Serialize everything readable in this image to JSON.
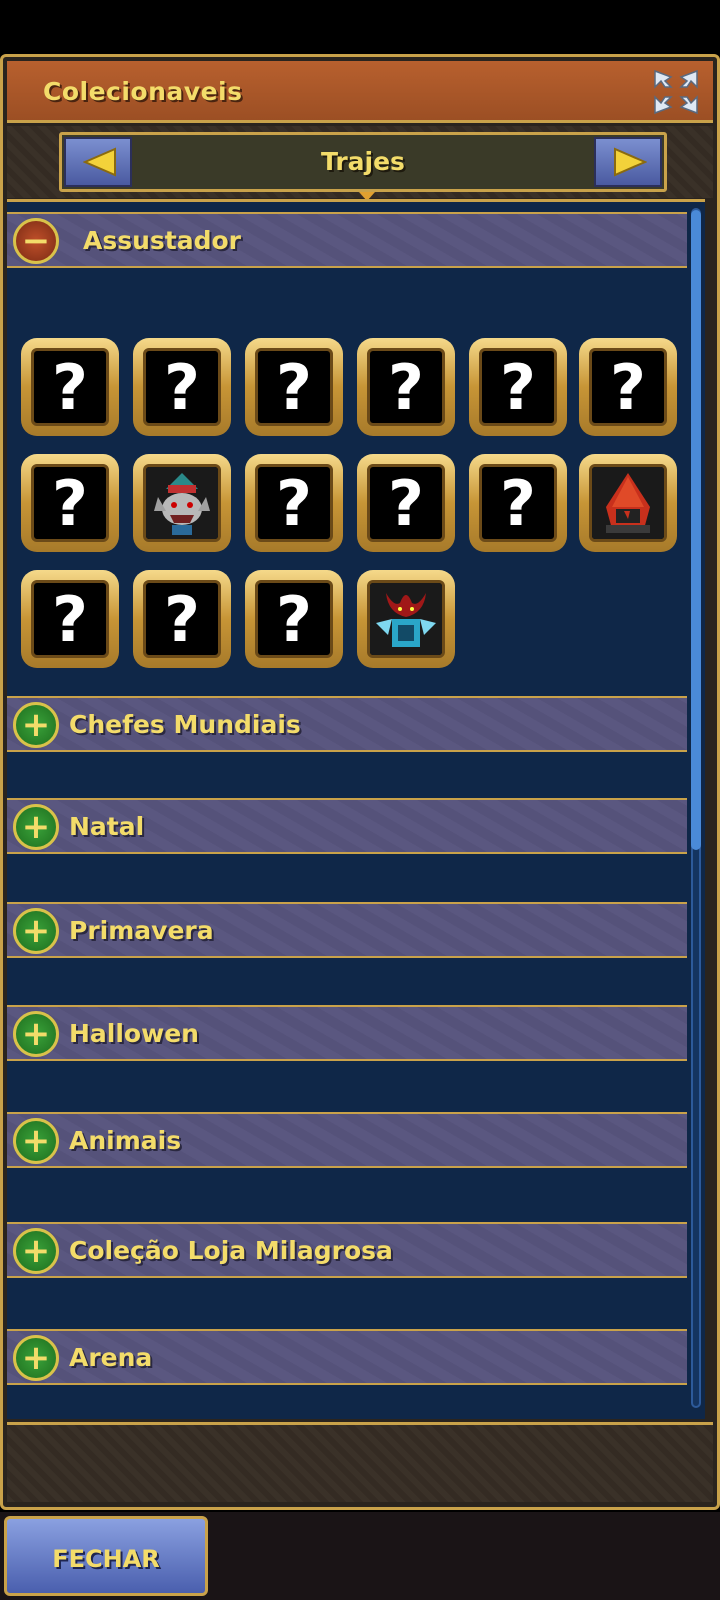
{
  "window": {
    "title": "Colecionaveis"
  },
  "tab": {
    "label": "Trajes"
  },
  "expanded_section": {
    "label": "Assustador",
    "items": [
      {
        "unknown_text": "?",
        "icon": "unknown"
      },
      {
        "unknown_text": "?",
        "icon": "unknown"
      },
      {
        "unknown_text": "?",
        "icon": "unknown"
      },
      {
        "unknown_text": "?",
        "icon": "unknown"
      },
      {
        "unknown_text": "?",
        "icon": "unknown"
      },
      {
        "unknown_text": "?",
        "icon": "unknown"
      },
      {
        "unknown_text": "?",
        "icon": "unknown"
      },
      {
        "unknown_text": "",
        "icon": "wolf-costume-icon"
      },
      {
        "unknown_text": "?",
        "icon": "unknown"
      },
      {
        "unknown_text": "?",
        "icon": "unknown"
      },
      {
        "unknown_text": "?",
        "icon": "unknown"
      },
      {
        "unknown_text": "",
        "icon": "red-hood-costume-icon"
      },
      {
        "unknown_text": "?",
        "icon": "unknown"
      },
      {
        "unknown_text": "?",
        "icon": "unknown"
      },
      {
        "unknown_text": "?",
        "icon": "unknown"
      },
      {
        "unknown_text": "",
        "icon": "demon-armor-costume-icon"
      }
    ]
  },
  "collapsed_sections": [
    {
      "label": "Chefes Mundiais"
    },
    {
      "label": "Natal"
    },
    {
      "label": "Primavera"
    },
    {
      "label": "Hallowen"
    },
    {
      "label": "Animais"
    },
    {
      "label": "Coleção Loja Milagrosa"
    },
    {
      "label": "Arena"
    }
  ],
  "footer": {
    "close_label": "FECHAR"
  },
  "colors": {
    "accent_gold": "#c9a24a",
    "text_yellow": "#f3dc6a",
    "panel_blue": "#0f2748",
    "title_orange": "#b8602e"
  }
}
